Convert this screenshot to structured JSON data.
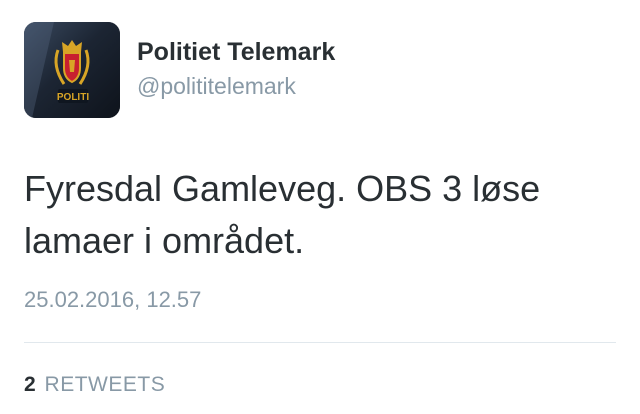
{
  "author": {
    "display_name": "Politiet Telemark",
    "handle": "@polititelemark",
    "avatar_icon": "police-badge-icon",
    "avatar_badge_text": "POLITI"
  },
  "tweet": {
    "text": "Fyresdal Gamleveg. OBS 3 løse lamaer i området.",
    "timestamp": "25.02.2016, 12.57"
  },
  "stats": {
    "retweets_count": "2",
    "retweets_label": "RETWEETS"
  },
  "colors": {
    "text_primary": "#292f33",
    "text_secondary": "#8899a6",
    "divider": "#e1e8ed",
    "badge_gold": "#d8a526",
    "badge_red": "#c8202f"
  }
}
